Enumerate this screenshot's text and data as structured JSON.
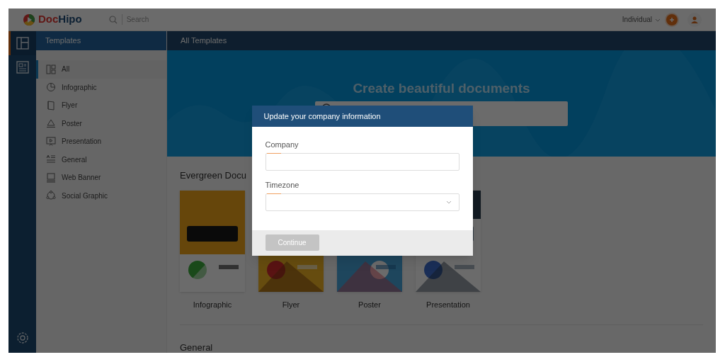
{
  "header": {
    "logo": {
      "first": "Doc",
      "second": "Hipo"
    },
    "search": {
      "placeholder": "Search"
    },
    "account": "Individual"
  },
  "rail": [
    {
      "kind": "layout",
      "selected": true
    },
    {
      "kind": "document",
      "selected": false
    },
    {
      "kind": "settings",
      "selected": false
    }
  ],
  "sidebar": {
    "title": "Templates",
    "items": [
      {
        "label": "All",
        "kind": "all",
        "selected": true
      },
      {
        "label": "Infographic",
        "kind": "infographic",
        "selected": false
      },
      {
        "label": "Flyer",
        "kind": "flyer",
        "selected": false
      },
      {
        "label": "Poster",
        "kind": "poster",
        "selected": false
      },
      {
        "label": "Presentation",
        "kind": "presentation",
        "selected": false
      },
      {
        "label": "General",
        "kind": "general",
        "selected": false
      },
      {
        "label": "Web Banner",
        "kind": "banner",
        "selected": false
      },
      {
        "label": "Social Graphic",
        "kind": "social",
        "selected": false
      }
    ]
  },
  "main": {
    "title": "All Templates",
    "banner": {
      "heading": "Create beautiful documents"
    },
    "sections": [
      {
        "title": "Evergreen Docu",
        "cards": [
          {
            "label": "Infographic",
            "kind": "picture"
          },
          {
            "label": "Flyer",
            "kind": "picture"
          },
          {
            "label": "Poster",
            "kind": "picture"
          },
          {
            "label": "Presentation",
            "kind": "picture"
          }
        ]
      },
      {
        "title": "General"
      }
    ]
  },
  "modal": {
    "title": "Update your company information",
    "fields": [
      {
        "label": "Company",
        "kind": "text"
      },
      {
        "label": "Timezone",
        "kind": "select"
      }
    ],
    "button": {
      "label": "Continue",
      "disabled": true
    }
  }
}
